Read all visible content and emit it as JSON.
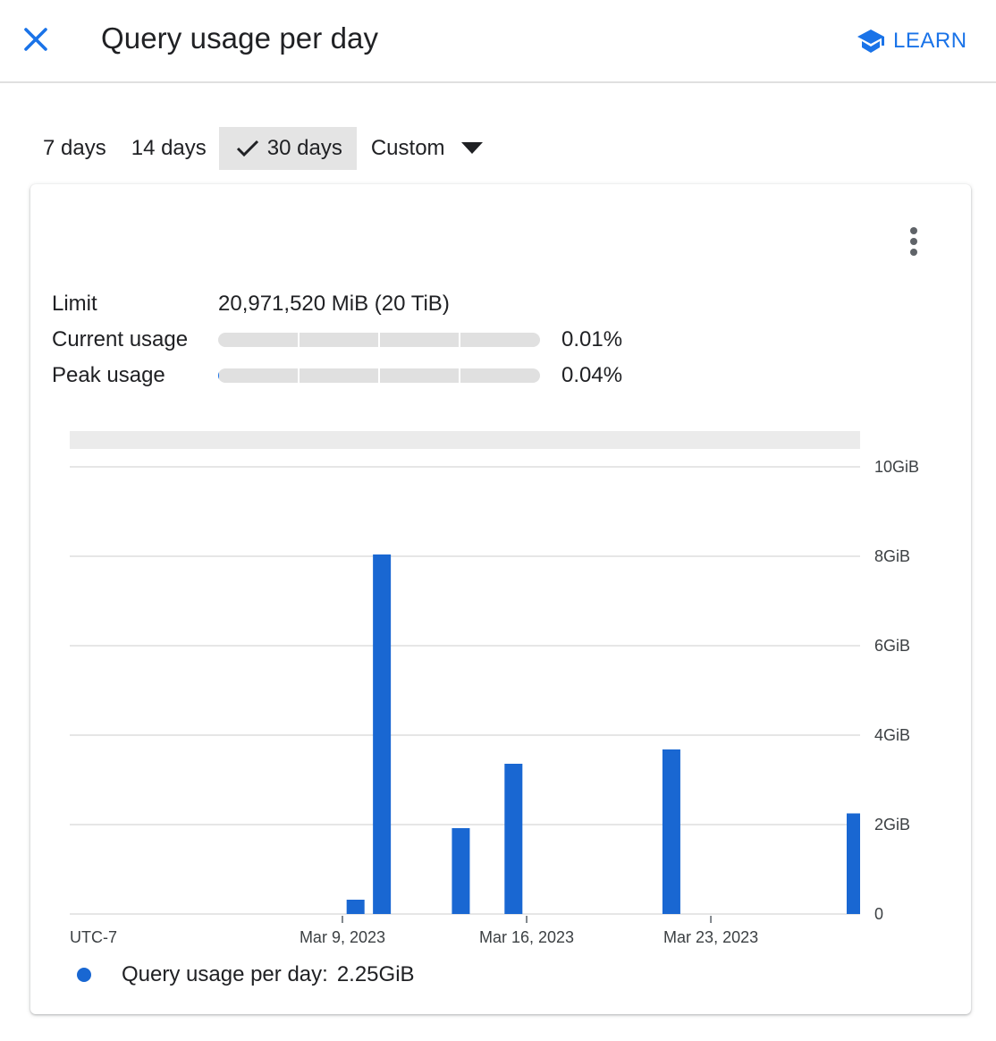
{
  "header": {
    "title": "Query usage per day",
    "learn_label": "LEARN",
    "close_icon": "close-icon",
    "learn_icon": "school-cap-icon",
    "accent": "#1a73e8"
  },
  "ranges": {
    "options": [
      {
        "label": "7 days",
        "selected": false
      },
      {
        "label": "14 days",
        "selected": false
      },
      {
        "label": "30 days",
        "selected": true
      },
      {
        "label": "Custom",
        "selected": false,
        "dropdown": true
      }
    ]
  },
  "card": {
    "menu_icon": "more-vert-icon",
    "limit_label": "Limit",
    "limit_value": "20,971,520 MiB (20 TiB)",
    "current_label": "Current usage",
    "current_pct_text": "0.01%",
    "current_pct": 0.01,
    "peak_label": "Peak usage",
    "peak_pct_text": "0.04%",
    "peak_pct": 0.04
  },
  "chart_data": {
    "type": "bar",
    "title": "Query usage per day",
    "xlabel": "UTC-7",
    "ylabel": "",
    "y_unit": "GiB",
    "ylim": [
      0,
      10
    ],
    "y_ticks": [
      {
        "value": 0,
        "label": "0"
      },
      {
        "value": 2,
        "label": "2GiB"
      },
      {
        "value": 4,
        "label": "4GiB"
      },
      {
        "value": 6,
        "label": "6GiB"
      },
      {
        "value": 8,
        "label": "8GiB"
      },
      {
        "value": 10,
        "label": "10GiB"
      }
    ],
    "x_range_days": [
      -10.36,
      19.67
    ],
    "x_ticks": [
      {
        "day": 0,
        "label": "Mar 9, 2023"
      },
      {
        "day": 7,
        "label": "Mar 16, 2023"
      },
      {
        "day": 14,
        "label": "Mar 23, 2023"
      }
    ],
    "x_reference": "Mar 9, 2023 = day 0",
    "grid": true,
    "series": [
      {
        "name": "Query usage per day",
        "color": "#1967d2",
        "points": [
          {
            "date": "Mar 9, 2023",
            "day": 0,
            "value": 0.32
          },
          {
            "date": "Mar 10, 2023",
            "day": 1,
            "value": 8.04
          },
          {
            "date": "Mar 13, 2023",
            "day": 4,
            "value": 1.92
          },
          {
            "date": "Mar 15, 2023",
            "day": 6,
            "value": 3.36
          },
          {
            "date": "Mar 21, 2023",
            "day": 12,
            "value": 3.68
          },
          {
            "date": "Mar 28, 2023",
            "day": 19,
            "value": 2.25
          }
        ]
      }
    ],
    "legend": {
      "position": "bottom-left",
      "label": "Query usage per day:",
      "value": "2.25GiB"
    }
  }
}
